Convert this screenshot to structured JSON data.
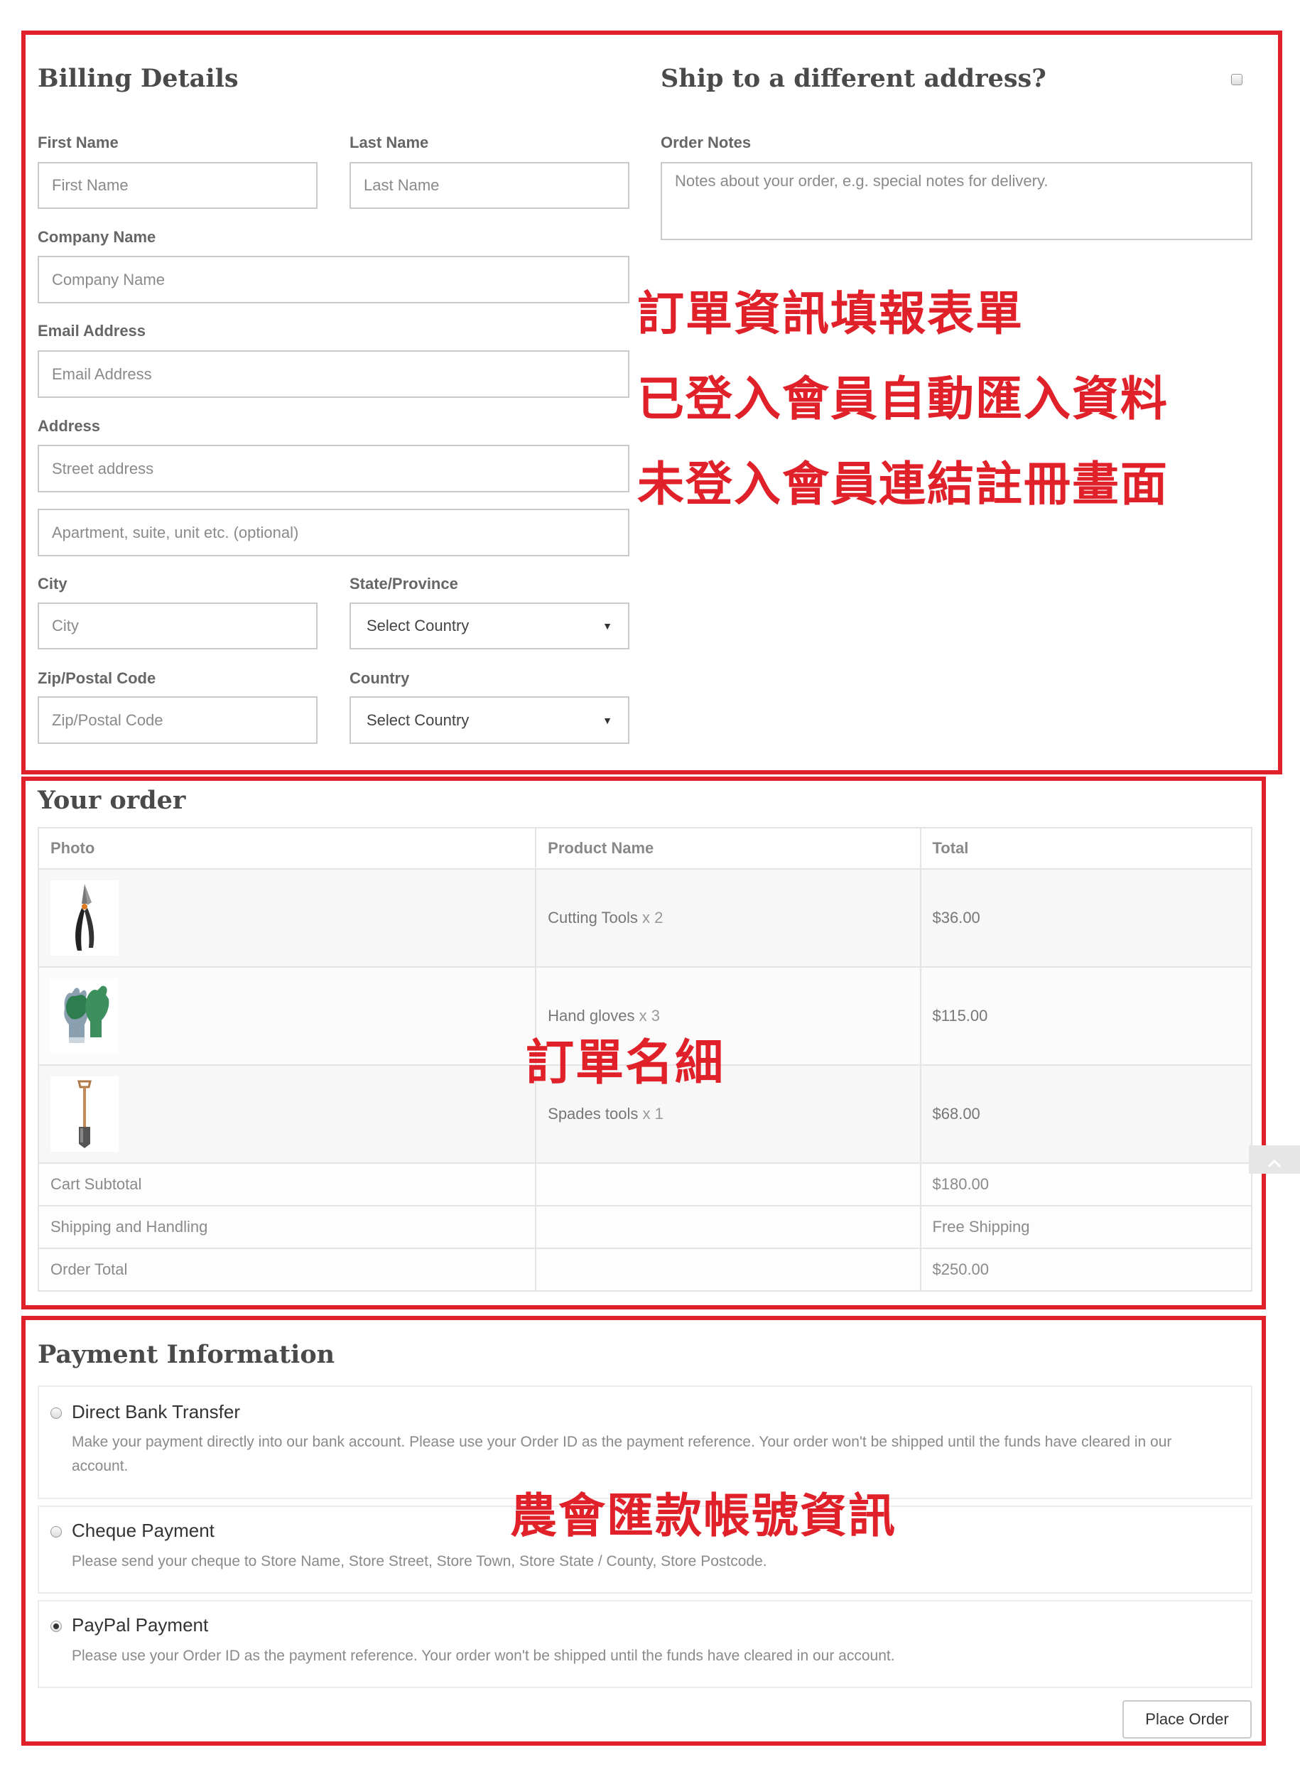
{
  "billing": {
    "title": "Billing Details",
    "first_name": {
      "label": "First Name",
      "placeholder": "First Name"
    },
    "last_name": {
      "label": "Last Name",
      "placeholder": "Last Name"
    },
    "company": {
      "label": "Company Name",
      "placeholder": "Company Name"
    },
    "email": {
      "label": "Email Address",
      "placeholder": "Email Address"
    },
    "address": {
      "label": "Address",
      "placeholder_street": "Street address",
      "placeholder_apt": "Apartment, suite, unit etc. (optional)"
    },
    "city": {
      "label": "City",
      "placeholder": "City"
    },
    "state": {
      "label": "State/Province",
      "selected": "Select Country"
    },
    "zip": {
      "label": "Zip/Postal Code",
      "placeholder": "Zip/Postal Code"
    },
    "country": {
      "label": "Country",
      "selected": "Select Country"
    }
  },
  "shipping": {
    "title": "Ship to a different address?",
    "checked": false,
    "order_notes": {
      "label": "Order Notes",
      "placeholder": "Notes about your order, e.g. special notes for delivery."
    }
  },
  "annotations": {
    "billing_lines": [
      "訂單資訊填報表單",
      "已登入會員自動匯入資料",
      "未登入會員連結註冊畫面"
    ],
    "order": "訂單名細",
    "payment": "農會匯款帳號資訊"
  },
  "order": {
    "title": "Your order",
    "headers": [
      "Photo",
      "Product Name",
      "Total"
    ],
    "items": [
      {
        "name": "Cutting Tools",
        "qty": "x 2",
        "total": "$36.00",
        "icon": "pruning-shears-icon"
      },
      {
        "name": "Hand gloves",
        "qty": "x 3",
        "total": "$115.00",
        "icon": "gloves-icon"
      },
      {
        "name": "Spades tools",
        "qty": "x 1",
        "total": "$68.00",
        "icon": "spade-icon"
      }
    ],
    "summary": [
      {
        "label": "Cart Subtotal",
        "value": "$180.00"
      },
      {
        "label": "Shipping and Handling",
        "value": "Free Shipping"
      },
      {
        "label": "Order Total",
        "value": "$250.00"
      }
    ]
  },
  "payment": {
    "title": "Payment Information",
    "methods": [
      {
        "name": "Direct Bank Transfer",
        "desc": "Make your payment directly into our bank account. Please use your Order ID as the payment reference. Your order won't be shipped until the funds have cleared in our account.",
        "selected": false
      },
      {
        "name": "Cheque Payment",
        "desc": "Please send your cheque to Store Name, Store Street, Store Town, Store State / County, Store Postcode.",
        "selected": false
      },
      {
        "name": "PayPal Payment",
        "desc": "Please use your Order ID as the payment reference. Your order won't be shipped until the funds have cleared in our account.",
        "selected": true
      }
    ],
    "place_order_label": "Place Order"
  },
  "colors": {
    "annotation_red": "#e02129",
    "border": "#c9c9c9"
  }
}
